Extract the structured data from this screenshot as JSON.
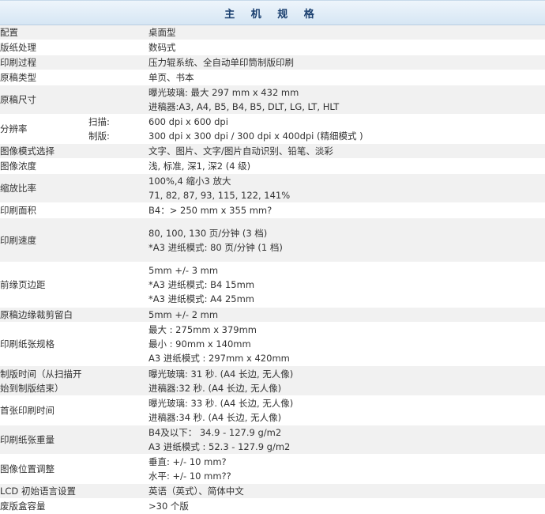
{
  "header": {
    "title": "主 机 规 格"
  },
  "rows": [
    {
      "label": "配置",
      "value": "桌面型"
    },
    {
      "label": "版纸处理",
      "value": "数码式"
    },
    {
      "label": "印刷过程",
      "value": "压力辊系统、全自动单印筒制版印刷"
    },
    {
      "label": "原稿类型",
      "value": "单页、书本"
    },
    {
      "label": "原稿尺寸",
      "lines": [
        "曝光玻璃: 最大 297 mm x 432 mm",
        "进稿器:A3, A4, B5, B4, B5, DLT, LG, LT, HLT"
      ]
    },
    {
      "label": "分辨率",
      "sublabels": [
        "扫描:",
        "制版:"
      ],
      "lines": [
        "600 dpi x 600 dpi",
        "300 dpi x 300 dpi / 300 dpi x 400dpi (精细模式 )"
      ]
    },
    {
      "label": "图像模式选择",
      "value": "文字、图片、文字/图片自动识别、铅笔、淡彩"
    },
    {
      "label": "图像浓度",
      "value": "浅, 标准, 深1, 深2 (4 级)"
    },
    {
      "label": "缩放比率",
      "lines": [
        "100%,4 缩小3 放大",
        "71, 82, 87, 93, 115, 122, 141%"
      ]
    },
    {
      "label": "印刷面积",
      "value": "B4：> 250 mm x 355 mm?"
    },
    {
      "label": "印刷速度",
      "lines": [
        "80, 100, 130 页/分钟 (3 档)",
        "*A3 进纸模式: 80 页/分钟 (1 档)"
      ]
    },
    {
      "label": "前缘页边距",
      "lines": [
        "5mm +/- 3 mm",
        "*A3 进纸模式: B4 15mm",
        "*A3 进纸模式: A4 25mm"
      ]
    },
    {
      "label": "原稿边缘裁剪留白",
      "value": "5mm +/- 2 mm"
    },
    {
      "label": "印刷纸张规格",
      "lines": [
        "最大 : 275mm x 379mm",
        "最小 : 90mm x 140mm",
        "A3 进纸模式 : 297mm x 420mm"
      ]
    },
    {
      "label": "制版时间（从扫描开始到制版结束）",
      "lines": [
        "曝光玻璃: 31 秒. (A4 长边, 无人像)",
        "进稿器:32 秒. (A4 长边, 无人像)"
      ]
    },
    {
      "label": "首张印刷时间",
      "lines": [
        "曝光玻璃: 33 秒. (A4 长边, 无人像)",
        "进稿器:34 秒. (A4 长边, 无人像)"
      ]
    },
    {
      "label": "印刷纸张重量",
      "lines": [
        "B4及以下： 34.9 - 127.9 g/m2",
        "A3 进纸模式 : 52.3 - 127.9 g/m2"
      ]
    },
    {
      "label": "图像位置调整",
      "lines": [
        "垂直: +/- 10 mm?",
        "水平: +/- 10 mm??"
      ]
    },
    {
      "label": "LCD 初始语言设置",
      "value": "英语（英式）、简体中文"
    },
    {
      "label": "废版盒容量",
      "value": ">30 个版"
    }
  ]
}
